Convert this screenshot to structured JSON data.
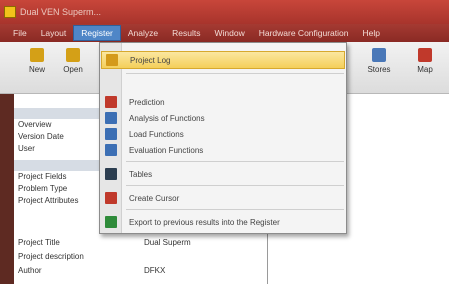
{
  "window": {
    "title": "Dual VEN Superm..."
  },
  "menubar": {
    "items": [
      {
        "label": "File"
      },
      {
        "label": "Layout"
      },
      {
        "label": "Register"
      },
      {
        "label": "Analyze"
      },
      {
        "label": "Results"
      },
      {
        "label": "Window"
      },
      {
        "label": "Hardware Configuration"
      },
      {
        "label": "Help"
      }
    ],
    "active_index": 2
  },
  "toolbar": {
    "items": [
      {
        "label": "New",
        "color": "#d4a017"
      },
      {
        "label": "Open",
        "color": "#d4a017"
      },
      {
        "label": "Stores",
        "color": "#4a78b8"
      },
      {
        "label": "Map",
        "color": "#c0392b"
      }
    ]
  },
  "dropdown": {
    "items": [
      {
        "label": "Project Log",
        "icon": "project-icon",
        "color": "#d49a1a",
        "highlighted": true
      },
      {
        "label": "Prediction",
        "icon": "prediction-icon",
        "color": "#c0392b"
      },
      {
        "label": "Analysis of Functions",
        "icon": "functions-icon",
        "color": "#3c6fb4"
      },
      {
        "label": "Load Functions",
        "icon": "load-icon",
        "color": "#3c6fb4"
      },
      {
        "label": "Evaluation Functions",
        "icon": "evaluation-icon",
        "color": "#3c6fb4"
      },
      {
        "label": "Tables",
        "icon": "tables-icon",
        "color": "#2c3e50"
      },
      {
        "label": "Create Cursor",
        "icon": "cursor-icon",
        "color": "#c0392b"
      },
      {
        "label": "Export to previous results into the Register",
        "icon": "export-icon",
        "color": "#2e8b3a"
      }
    ]
  },
  "properties": {
    "rows": [
      {
        "name": "Overview",
        "value": ""
      },
      {
        "name": "Version Date",
        "value": ""
      },
      {
        "name": "User",
        "value": ""
      },
      {
        "name": "Project Fields",
        "value": ""
      },
      {
        "name": "Problem Type",
        "value": ""
      },
      {
        "name": "Project Attributes",
        "value": ""
      },
      {
        "name": "Project Title",
        "value": "Dual Superm"
      },
      {
        "name": "Project description",
        "value": ""
      },
      {
        "name": "Author",
        "value": "DFKX"
      }
    ]
  }
}
